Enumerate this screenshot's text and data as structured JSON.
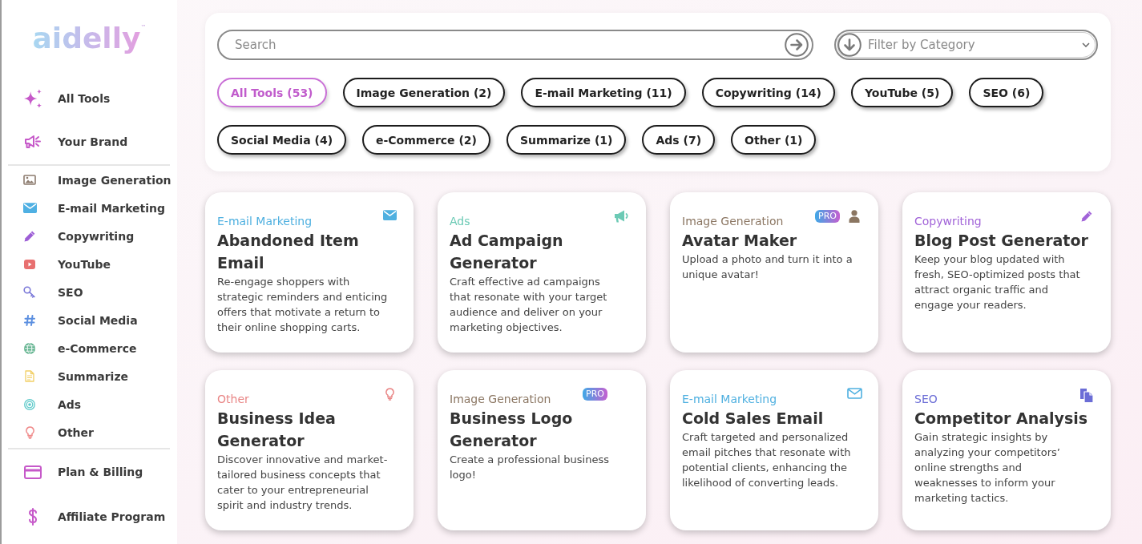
{
  "sidebar": {
    "logo": "aidelly",
    "logo_mark": "™",
    "primary_items": [
      {
        "label": "All Tools"
      },
      {
        "label": "Your Brand"
      }
    ],
    "category_items": [
      {
        "label": "Image Generation"
      },
      {
        "label": "E-mail Marketing"
      },
      {
        "label": "Copywriting"
      },
      {
        "label": "YouTube"
      },
      {
        "label": "SEO"
      },
      {
        "label": "Social Media"
      },
      {
        "label": "e-Commerce"
      },
      {
        "label": "Summarize"
      },
      {
        "label": "Ads"
      },
      {
        "label": "Other"
      }
    ],
    "account_items": [
      {
        "label": "Plan & Billing"
      },
      {
        "label": "Affiliate Program"
      }
    ]
  },
  "search": {
    "placeholder": "Search"
  },
  "category_filter": {
    "placeholder": "Filter by Category"
  },
  "chips": [
    {
      "label": "All Tools (53)",
      "selected": true
    },
    {
      "label": "Image Generation (2)",
      "selected": false
    },
    {
      "label": "E-mail Marketing (11)",
      "selected": false
    },
    {
      "label": "Copywriting (14)",
      "selected": false
    },
    {
      "label": "YouTube (5)",
      "selected": false
    },
    {
      "label": "SEO (6)",
      "selected": false
    },
    {
      "label": "Social Media (4)",
      "selected": false
    },
    {
      "label": "e-Commerce (2)",
      "selected": false
    },
    {
      "label": "Summarize (1)",
      "selected": false
    },
    {
      "label": "Ads (7)",
      "selected": false
    },
    {
      "label": "Other (1)",
      "selected": false
    }
  ],
  "cards": [
    {
      "category": "E-mail Marketing",
      "color": "#4fb0e0",
      "title": "Abandoned Item Email",
      "description": "Re-engage shoppers with strategic reminders and enticing offers that motivate a return to their online shopping carts."
    },
    {
      "category": "Ads",
      "color": "#6ccab5",
      "title": "Ad Campaign Generator",
      "description": "Craft effective ad campaigns that resonate with your target audience and deliver on your marketing objectives."
    },
    {
      "category": "Image Generation",
      "color": "#8b7662",
      "title": "Avatar Maker",
      "badge": "PRO",
      "description": "Upload a photo and turn it into a unique avatar!"
    },
    {
      "category": "Copywriting",
      "color": "#a163d8",
      "title": "Blog Post Generator",
      "description": "Keep your blog updated with fresh, SEO-optimized posts that attract organic traffic and engage your readers."
    },
    {
      "category": "Other",
      "color": "#e98686",
      "title": "Business Idea Generator",
      "description": "Discover innovative and market-tailored business concepts that cater to your entrepreneurial spirit and industry trends."
    },
    {
      "category": "Image Generation",
      "color": "#8b7662",
      "title": "Business Logo Generator",
      "badge": "PRO",
      "description": "Create a professional business logo!"
    },
    {
      "category": "E-mail Marketing",
      "color": "#4fb0e0",
      "title": "Cold Sales Email",
      "description": "Craft targeted and personalized email pitches that resonate with potential clients, enhancing the likelihood of converting leads."
    },
    {
      "category": "SEO",
      "color": "#6b6dd6",
      "title": "Competitor Analysis",
      "description": "Gain strategic insights by analyzing your competitors’ online strengths and weaknesses to inform your marketing tactics."
    }
  ]
}
